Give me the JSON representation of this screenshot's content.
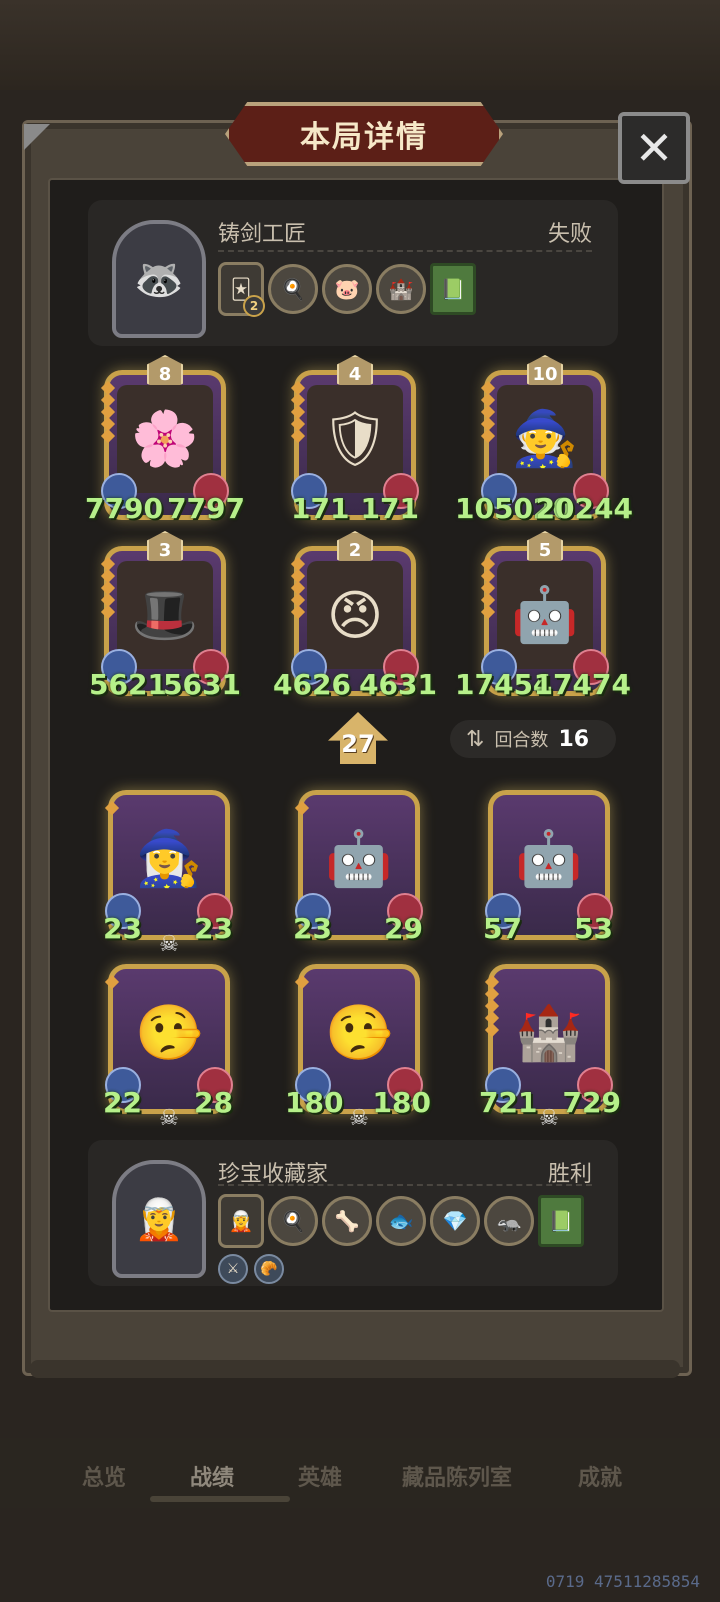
{
  "title": "本局详情",
  "close_icon": "✕",
  "opponent": {
    "name": "铸剑工匠",
    "result": "失败",
    "avatar_icon": "🦝",
    "items": [
      {
        "icon": "🃏",
        "badge": "2"
      },
      {
        "icon": "🍳"
      },
      {
        "icon": "🐷"
      },
      {
        "icon": "🏰"
      },
      {
        "icon": "📗"
      }
    ]
  },
  "enemy_cards": [
    {
      "level": "8",
      "atk": "7790",
      "hp": "7797",
      "icon": "🌸",
      "stars": 5
    },
    {
      "level": "4",
      "atk": "171",
      "hp": "171",
      "icon": "🛡",
      "stars": 5
    },
    {
      "level": "10",
      "atk": "105020",
      "hp": "20244",
      "icon": "🧙",
      "stars": 5
    },
    {
      "level": "3",
      "atk": "5621",
      "hp": "5631",
      "icon": "🎩",
      "stars": 5
    },
    {
      "level": "2",
      "atk": "4626",
      "hp": "4631",
      "icon": "😠",
      "stars": 5
    },
    {
      "level": "5",
      "atk": "17454",
      "hp": "17474",
      "icon": "🤖",
      "stars": 5
    }
  ],
  "tavern_level": "27",
  "turns": {
    "icon": "⇅",
    "label": "回合数",
    "value": "16"
  },
  "player_cards": [
    {
      "atk": "23",
      "hp": "23",
      "icon": "🧙‍♀️"
    },
    {
      "atk": "23",
      "hp": "29",
      "icon": "🤖"
    },
    {
      "atk": "57",
      "hp": "53",
      "icon": "🤖"
    },
    {
      "atk": "22",
      "hp": "28",
      "icon": "🤥"
    },
    {
      "atk": "180",
      "hp": "180",
      "icon": "🤥"
    },
    {
      "atk": "721",
      "hp": "729",
      "icon": "🏰"
    }
  ],
  "player": {
    "name": "珍宝收藏家",
    "result": "胜利",
    "avatar_icon": "🧝",
    "items": [
      {
        "icon": "🧝"
      },
      {
        "icon": "🍳"
      },
      {
        "icon": "🦴"
      },
      {
        "icon": "🐟"
      },
      {
        "icon": "💎"
      },
      {
        "icon": "🦡"
      },
      {
        "icon": "📗"
      }
    ],
    "small_icons": [
      "⚔",
      "🥐"
    ]
  },
  "tabs": [
    "总览",
    "战绩",
    "英雄",
    "藏品陈列室",
    "成就"
  ],
  "active_tab": "战绩",
  "footer_id": "0719 47511285854"
}
